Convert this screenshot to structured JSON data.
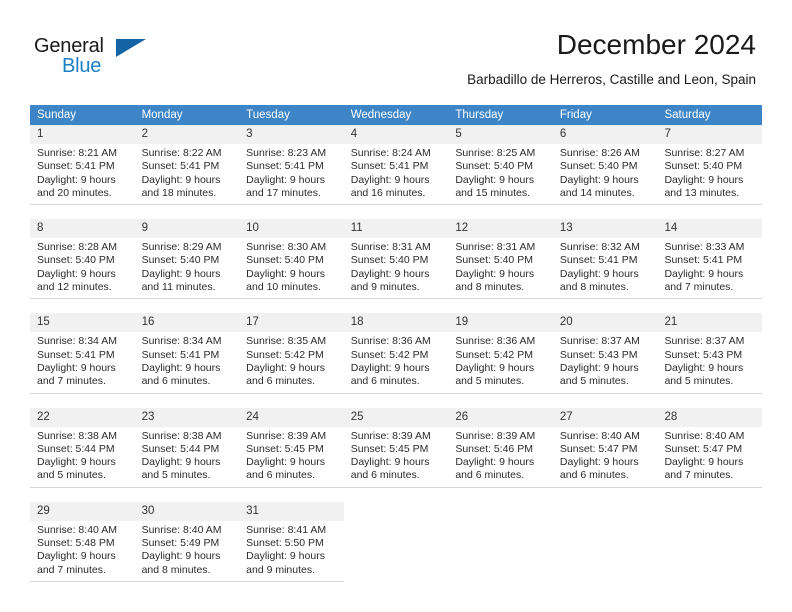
{
  "brand": {
    "name_part1": "General",
    "name_part2": "Blue",
    "flag_icon": "blue-flag-icon",
    "accent_color": "#1a7fc4"
  },
  "header": {
    "title": "December 2024",
    "subtitle": "Barbadillo de Herreros, Castille and Leon, Spain"
  },
  "calendar": {
    "header_bg": "#3d85c6",
    "day_num_bg": "#f1f1f1",
    "weekday_headers": [
      "Sunday",
      "Monday",
      "Tuesday",
      "Wednesday",
      "Thursday",
      "Friday",
      "Saturday"
    ],
    "weeks": [
      [
        {
          "day": "1",
          "sunrise": "Sunrise: 8:21 AM",
          "sunset": "Sunset: 5:41 PM",
          "daylight_line1": "Daylight: 9 hours",
          "daylight_line2": "and 20 minutes."
        },
        {
          "day": "2",
          "sunrise": "Sunrise: 8:22 AM",
          "sunset": "Sunset: 5:41 PM",
          "daylight_line1": "Daylight: 9 hours",
          "daylight_line2": "and 18 minutes."
        },
        {
          "day": "3",
          "sunrise": "Sunrise: 8:23 AM",
          "sunset": "Sunset: 5:41 PM",
          "daylight_line1": "Daylight: 9 hours",
          "daylight_line2": "and 17 minutes."
        },
        {
          "day": "4",
          "sunrise": "Sunrise: 8:24 AM",
          "sunset": "Sunset: 5:41 PM",
          "daylight_line1": "Daylight: 9 hours",
          "daylight_line2": "and 16 minutes."
        },
        {
          "day": "5",
          "sunrise": "Sunrise: 8:25 AM",
          "sunset": "Sunset: 5:40 PM",
          "daylight_line1": "Daylight: 9 hours",
          "daylight_line2": "and 15 minutes."
        },
        {
          "day": "6",
          "sunrise": "Sunrise: 8:26 AM",
          "sunset": "Sunset: 5:40 PM",
          "daylight_line1": "Daylight: 9 hours",
          "daylight_line2": "and 14 minutes."
        },
        {
          "day": "7",
          "sunrise": "Sunrise: 8:27 AM",
          "sunset": "Sunset: 5:40 PM",
          "daylight_line1": "Daylight: 9 hours",
          "daylight_line2": "and 13 minutes."
        }
      ],
      [
        {
          "day": "8",
          "sunrise": "Sunrise: 8:28 AM",
          "sunset": "Sunset: 5:40 PM",
          "daylight_line1": "Daylight: 9 hours",
          "daylight_line2": "and 12 minutes."
        },
        {
          "day": "9",
          "sunrise": "Sunrise: 8:29 AM",
          "sunset": "Sunset: 5:40 PM",
          "daylight_line1": "Daylight: 9 hours",
          "daylight_line2": "and 11 minutes."
        },
        {
          "day": "10",
          "sunrise": "Sunrise: 8:30 AM",
          "sunset": "Sunset: 5:40 PM",
          "daylight_line1": "Daylight: 9 hours",
          "daylight_line2": "and 10 minutes."
        },
        {
          "day": "11",
          "sunrise": "Sunrise: 8:31 AM",
          "sunset": "Sunset: 5:40 PM",
          "daylight_line1": "Daylight: 9 hours",
          "daylight_line2": "and 9 minutes."
        },
        {
          "day": "12",
          "sunrise": "Sunrise: 8:31 AM",
          "sunset": "Sunset: 5:40 PM",
          "daylight_line1": "Daylight: 9 hours",
          "daylight_line2": "and 8 minutes."
        },
        {
          "day": "13",
          "sunrise": "Sunrise: 8:32 AM",
          "sunset": "Sunset: 5:41 PM",
          "daylight_line1": "Daylight: 9 hours",
          "daylight_line2": "and 8 minutes."
        },
        {
          "day": "14",
          "sunrise": "Sunrise: 8:33 AM",
          "sunset": "Sunset: 5:41 PM",
          "daylight_line1": "Daylight: 9 hours",
          "daylight_line2": "and 7 minutes."
        }
      ],
      [
        {
          "day": "15",
          "sunrise": "Sunrise: 8:34 AM",
          "sunset": "Sunset: 5:41 PM",
          "daylight_line1": "Daylight: 9 hours",
          "daylight_line2": "and 7 minutes."
        },
        {
          "day": "16",
          "sunrise": "Sunrise: 8:34 AM",
          "sunset": "Sunset: 5:41 PM",
          "daylight_line1": "Daylight: 9 hours",
          "daylight_line2": "and 6 minutes."
        },
        {
          "day": "17",
          "sunrise": "Sunrise: 8:35 AM",
          "sunset": "Sunset: 5:42 PM",
          "daylight_line1": "Daylight: 9 hours",
          "daylight_line2": "and 6 minutes."
        },
        {
          "day": "18",
          "sunrise": "Sunrise: 8:36 AM",
          "sunset": "Sunset: 5:42 PM",
          "daylight_line1": "Daylight: 9 hours",
          "daylight_line2": "and 6 minutes."
        },
        {
          "day": "19",
          "sunrise": "Sunrise: 8:36 AM",
          "sunset": "Sunset: 5:42 PM",
          "daylight_line1": "Daylight: 9 hours",
          "daylight_line2": "and 5 minutes."
        },
        {
          "day": "20",
          "sunrise": "Sunrise: 8:37 AM",
          "sunset": "Sunset: 5:43 PM",
          "daylight_line1": "Daylight: 9 hours",
          "daylight_line2": "and 5 minutes."
        },
        {
          "day": "21",
          "sunrise": "Sunrise: 8:37 AM",
          "sunset": "Sunset: 5:43 PM",
          "daylight_line1": "Daylight: 9 hours",
          "daylight_line2": "and 5 minutes."
        }
      ],
      [
        {
          "day": "22",
          "sunrise": "Sunrise: 8:38 AM",
          "sunset": "Sunset: 5:44 PM",
          "daylight_line1": "Daylight: 9 hours",
          "daylight_line2": "and 5 minutes."
        },
        {
          "day": "23",
          "sunrise": "Sunrise: 8:38 AM",
          "sunset": "Sunset: 5:44 PM",
          "daylight_line1": "Daylight: 9 hours",
          "daylight_line2": "and 5 minutes."
        },
        {
          "day": "24",
          "sunrise": "Sunrise: 8:39 AM",
          "sunset": "Sunset: 5:45 PM",
          "daylight_line1": "Daylight: 9 hours",
          "daylight_line2": "and 6 minutes."
        },
        {
          "day": "25",
          "sunrise": "Sunrise: 8:39 AM",
          "sunset": "Sunset: 5:45 PM",
          "daylight_line1": "Daylight: 9 hours",
          "daylight_line2": "and 6 minutes."
        },
        {
          "day": "26",
          "sunrise": "Sunrise: 8:39 AM",
          "sunset": "Sunset: 5:46 PM",
          "daylight_line1": "Daylight: 9 hours",
          "daylight_line2": "and 6 minutes."
        },
        {
          "day": "27",
          "sunrise": "Sunrise: 8:40 AM",
          "sunset": "Sunset: 5:47 PM",
          "daylight_line1": "Daylight: 9 hours",
          "daylight_line2": "and 6 minutes."
        },
        {
          "day": "28",
          "sunrise": "Sunrise: 8:40 AM",
          "sunset": "Sunset: 5:47 PM",
          "daylight_line1": "Daylight: 9 hours",
          "daylight_line2": "and 7 minutes."
        }
      ],
      [
        {
          "day": "29",
          "sunrise": "Sunrise: 8:40 AM",
          "sunset": "Sunset: 5:48 PM",
          "daylight_line1": "Daylight: 9 hours",
          "daylight_line2": "and 7 minutes."
        },
        {
          "day": "30",
          "sunrise": "Sunrise: 8:40 AM",
          "sunset": "Sunset: 5:49 PM",
          "daylight_line1": "Daylight: 9 hours",
          "daylight_line2": "and 8 minutes."
        },
        {
          "day": "31",
          "sunrise": "Sunrise: 8:41 AM",
          "sunset": "Sunset: 5:50 PM",
          "daylight_line1": "Daylight: 9 hours",
          "daylight_line2": "and 9 minutes."
        },
        {
          "day": "",
          "sunrise": "",
          "sunset": "",
          "daylight_line1": "",
          "daylight_line2": ""
        },
        {
          "day": "",
          "sunrise": "",
          "sunset": "",
          "daylight_line1": "",
          "daylight_line2": ""
        },
        {
          "day": "",
          "sunrise": "",
          "sunset": "",
          "daylight_line1": "",
          "daylight_line2": ""
        },
        {
          "day": "",
          "sunrise": "",
          "sunset": "",
          "daylight_line1": "",
          "daylight_line2": ""
        }
      ]
    ]
  }
}
